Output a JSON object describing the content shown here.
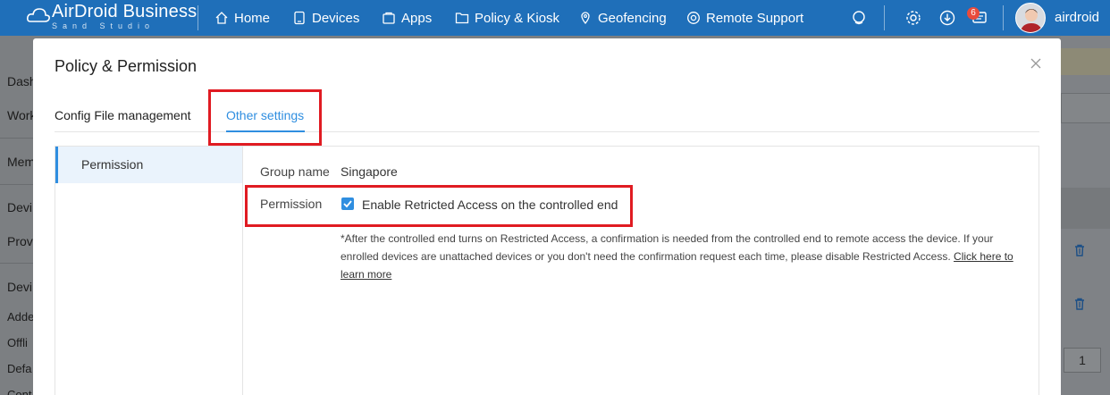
{
  "app": {
    "brand_name": "AirDroid Business",
    "brand_sub": "Sand Studio"
  },
  "nav": {
    "items": [
      {
        "label": "Home",
        "icon": "home-icon"
      },
      {
        "label": "Devices",
        "icon": "devices-icon"
      },
      {
        "label": "Apps",
        "icon": "apps-icon"
      },
      {
        "label": "Policy & Kiosk",
        "icon": "folder-icon"
      },
      {
        "label": "Geofencing",
        "icon": "geofence-icon"
      },
      {
        "label": "Remote Support",
        "icon": "support-icon"
      }
    ],
    "notification_count": "6",
    "username": "airdroid"
  },
  "background": {
    "sidebar_fragments": [
      "Dash",
      "Work",
      "Mem",
      "Devi",
      "Prov",
      "Devi",
      "Adde",
      "Offli",
      "Defa",
      "Cont"
    ],
    "pager_value": "1"
  },
  "modal": {
    "title": "Policy & Permission",
    "tabs": [
      {
        "label": "Config File management",
        "active": false
      },
      {
        "label": "Other settings",
        "active": true
      }
    ],
    "side_menu": [
      {
        "label": "Permission",
        "active": true
      }
    ],
    "group_name_label": "Group name",
    "group_name_value": "Singapore",
    "permission_label": "Permission",
    "restricted_access_label": "Enable Retricted Access on the controlled end",
    "restricted_access_checked": true,
    "note_text": "*After the controlled end turns on Restricted Access, a confirmation is needed from the controlled end to remote access the device. If your enrolled devices are unattached devices or you don't need the confirmation request each time, please disable Restricted Access.",
    "note_link": "Click here to learn more"
  },
  "colors": {
    "topbar": "#1f6fb9",
    "accent": "#2f8ee0",
    "annotation_red": "#e01b22",
    "badge": "#e84b3c"
  }
}
